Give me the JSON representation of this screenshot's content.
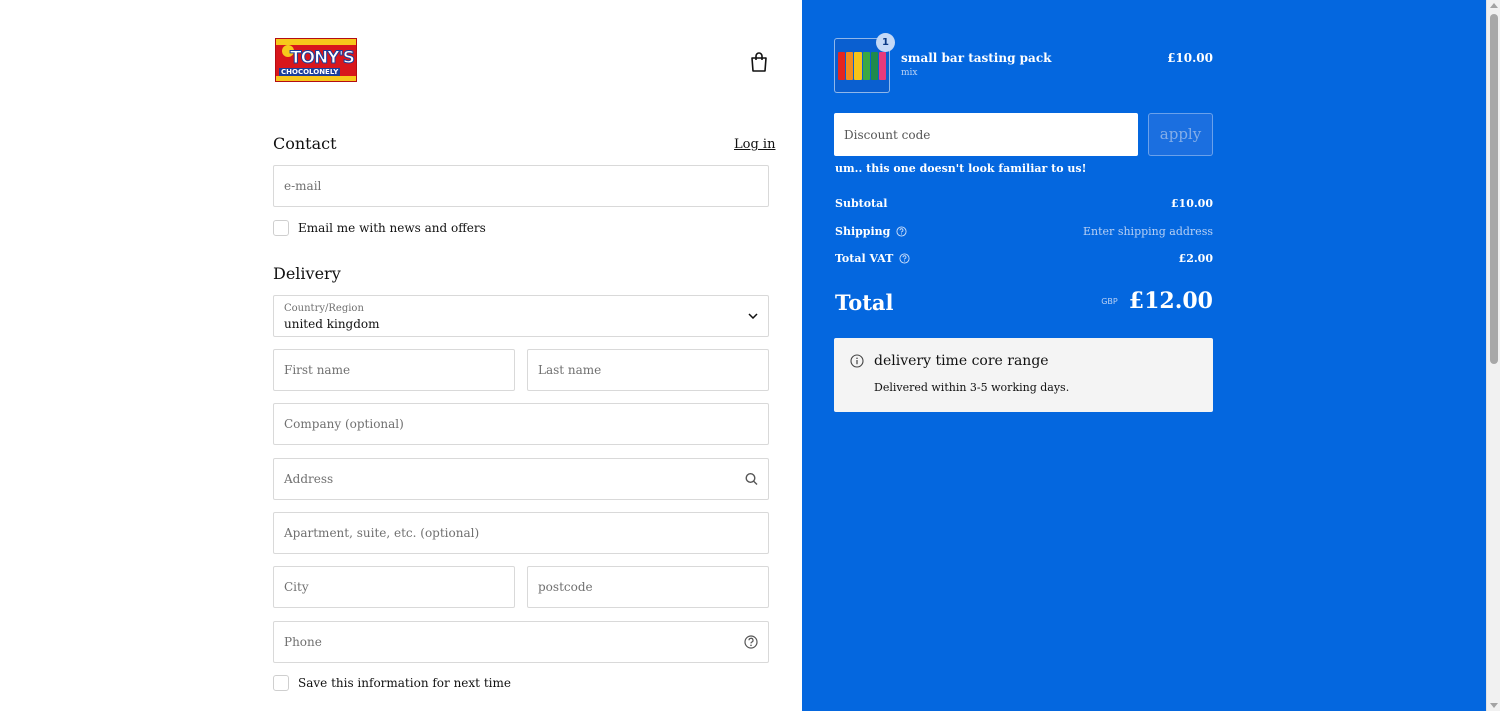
{
  "logo": {
    "text": "TONY'S",
    "subtext": "CHOCOLONELY"
  },
  "contact": {
    "title": "Contact",
    "login_label": "Log in",
    "email_placeholder": "e-mail",
    "news_label": "Email me with news and offers"
  },
  "delivery": {
    "title": "Delivery",
    "country_label": "Country/Region",
    "country_value": "united kingdom",
    "first_name_placeholder": "First name",
    "last_name_placeholder": "Last name",
    "company_placeholder": "Company (optional)",
    "address_placeholder": "Address",
    "apartment_placeholder": "Apartment, suite, etc. (optional)",
    "city_placeholder": "City",
    "postcode_placeholder": "postcode",
    "phone_placeholder": "Phone",
    "save_label": "Save this information for next time"
  },
  "cart": {
    "item": {
      "name": "small bar tasting pack",
      "variant": "mix",
      "price": "£10.00",
      "quantity": "1"
    },
    "discount_placeholder": "Discount code",
    "apply_label": "apply",
    "error_message": "um.. this one doesn't look familiar to us!",
    "subtotal_label": "Subtotal",
    "subtotal_value": "£10.00",
    "shipping_label": "Shipping",
    "shipping_value": "Enter shipping address",
    "vat_label": "Total VAT",
    "vat_value": "£2.00",
    "total_label": "Total",
    "total_currency": "GBP",
    "total_value": "£12.00"
  },
  "info": {
    "title": "delivery time core range",
    "body": "Delivered within 3-5 working days."
  },
  "colors": {
    "panel_blue": "#0467df",
    "logo_red": "#d8161c",
    "logo_yellow": "#f7c81b"
  }
}
